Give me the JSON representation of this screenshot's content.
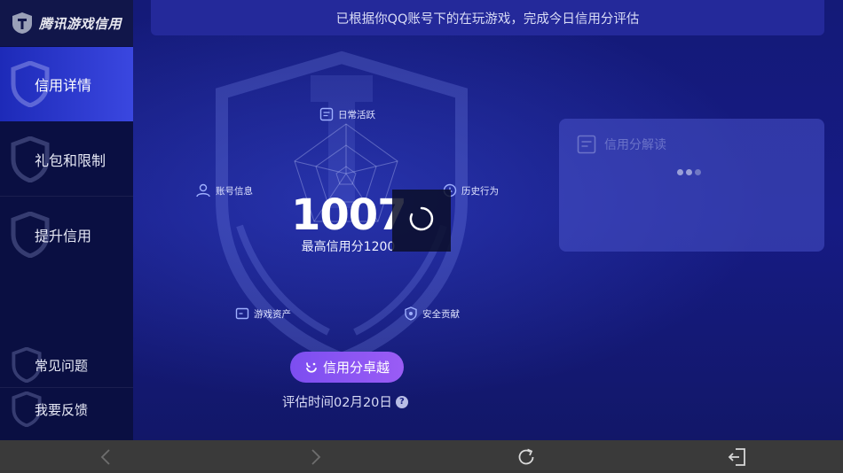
{
  "app": {
    "title": "腾讯游戏信用"
  },
  "sidebar": {
    "items": [
      {
        "label": "信用详情",
        "active": true
      },
      {
        "label": "礼包和限制",
        "active": false
      },
      {
        "label": "提升信用",
        "active": false
      }
    ],
    "bottom_items": [
      {
        "label": "常见问题"
      },
      {
        "label": "我要反馈"
      }
    ]
  },
  "notice": {
    "text": "已根据你QQ账号下的在玩游戏，完成今日信用分评估"
  },
  "radar": {
    "axes": [
      {
        "label": "日常活跃",
        "icon": "document-icon"
      },
      {
        "label": "历史行为",
        "icon": "clock-icon"
      },
      {
        "label": "安全贡献",
        "icon": "shield-icon"
      },
      {
        "label": "游戏资产",
        "icon": "wallet-icon"
      },
      {
        "label": "账号信息",
        "icon": "user-icon"
      }
    ]
  },
  "score": {
    "value": "1007",
    "max_text": "最高信用分1200"
  },
  "cta": {
    "label": "信用分卓越"
  },
  "eval": {
    "text": "评估时间02月20日",
    "help": "?"
  },
  "panel": {
    "title": "信用分解读"
  },
  "colors": {
    "accent": "#3a47e0",
    "cta": "#8a55f2",
    "background": "#141a78"
  }
}
